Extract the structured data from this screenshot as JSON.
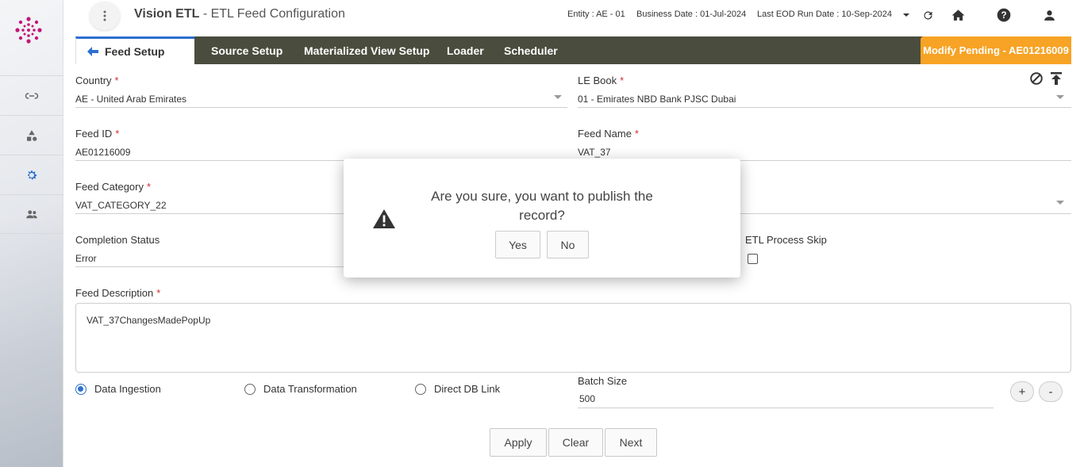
{
  "header": {
    "app_name": "Vision ETL",
    "page_title": " - ETL Feed Configuration",
    "entity": "Entity : AE - 01",
    "business_date": "Business Date : 01-Jul-2024",
    "last_eod": "Last EOD Run Date : 10-Sep-2024"
  },
  "tabs": {
    "active": "Feed Setup",
    "items": [
      "Source Setup",
      "Materialized View Setup",
      "Loader",
      "Scheduler"
    ],
    "status": "Modify Pending - AE01216009"
  },
  "form": {
    "country_label": "Country",
    "country_value": "AE - United Arab Emirates",
    "lebook_label": "LE Book",
    "lebook_value": "01 - Emirates NBD Bank PJSC Dubai",
    "feedid_label": "Feed ID",
    "feedid_value": "AE01216009",
    "feedname_label": "Feed Name",
    "feedname_value": "VAT_37",
    "category_label": "Feed Category",
    "category_value": "VAT_CATEGORY_22",
    "completion_label": "Completion Status",
    "completion_value": "Error",
    "etlskip_label": "ETL Process Skip",
    "description_label": "Feed Description",
    "description_value": "VAT_37ChangesMadePopUp",
    "batch_label": "Batch Size",
    "batch_value": "500",
    "required_mark": "*"
  },
  "radios": {
    "ingestion": "Data Ingestion",
    "transformation": "Data Transformation",
    "dblink": "Direct DB Link",
    "selected": "Data Ingestion"
  },
  "stepper": {
    "plus": "+",
    "minus": "-"
  },
  "actions": {
    "apply": "Apply",
    "clear": "Clear",
    "next": "Next"
  },
  "modal": {
    "message": "Are you sure, you want to publish the record?",
    "yes": "Yes",
    "no": "No"
  },
  "colors": {
    "accent": "#2d6fce",
    "tabbar": "#4a4d3e",
    "pending": "#f7a325",
    "required": "#d32f2f"
  }
}
